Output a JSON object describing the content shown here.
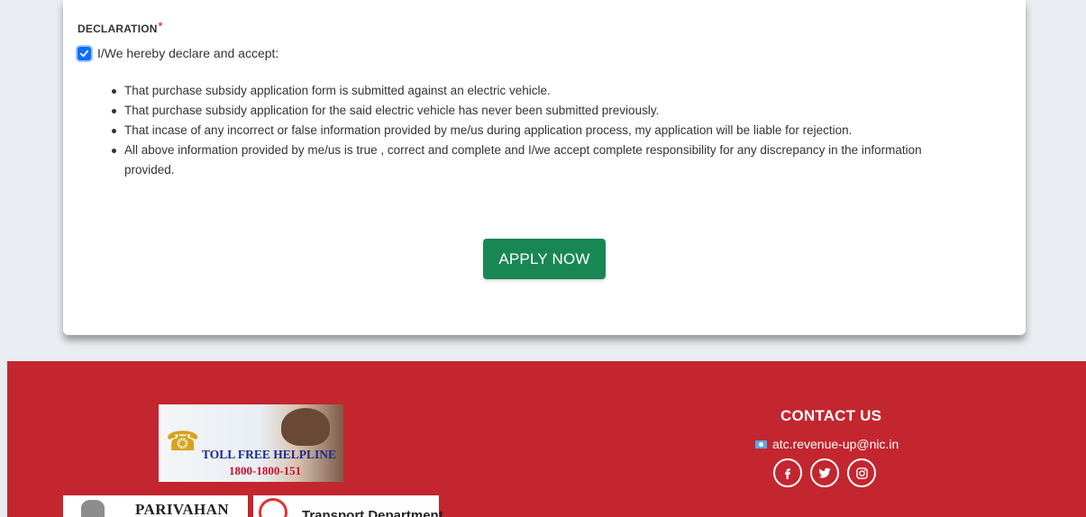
{
  "declaration": {
    "title": "DECLARATION",
    "required_mark": "*",
    "accept_label": "I/We hereby declare and accept:",
    "accepted": true,
    "points": [
      "That purchase subsidy application form is submitted against an electric vehicle.",
      "That purchase subsidy application for the said electric vehicle has never been submitted previously.",
      "That incase of any incorrect or false information provided by me/us during application process, my application will be liable for rejection.",
      "All above information provided by me/us is true , correct and complete and I/we accept complete responsibility for any discrepancy in the information provided."
    ],
    "apply_label": "APPLY NOW"
  },
  "footer": {
    "helpline": {
      "title": "TOLL FREE HELPLINE",
      "number": "1800-1800-151"
    },
    "logos": {
      "parivahan": "PARIVAHAN",
      "transport": "Transport Department"
    },
    "contact": {
      "title": "CONTACT US",
      "email": "atc.revenue-up@nic.in",
      "socials": [
        "facebook-icon",
        "twitter-icon",
        "instagram-icon"
      ]
    }
  },
  "colors": {
    "page_bg": "#e9edf1",
    "accent_blue": "#0d6efd",
    "apply_green": "#198754",
    "footer_red": "#c3262f",
    "required_red": "#dc3545"
  }
}
